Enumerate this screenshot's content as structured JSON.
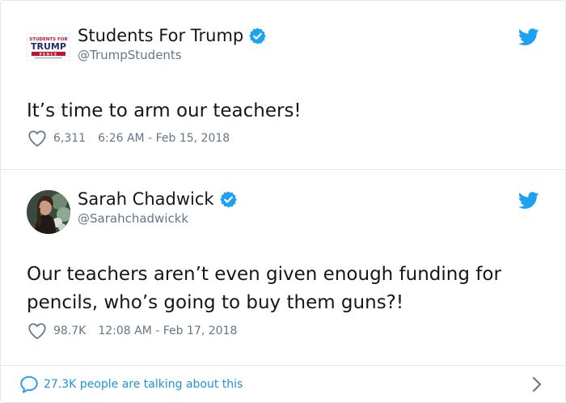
{
  "tweets": [
    {
      "display_name": "Students For Trump",
      "handle": "@TrumpStudents",
      "verified": true,
      "avatar_logo": {
        "top": "STUDENTS FOR",
        "main": "TRUMP",
        "bottom": "PENCE"
      },
      "text": "It’s time to arm our teachers!",
      "likes": "6,311",
      "timestamp": "6:26 AM - Feb 15, 2018"
    },
    {
      "display_name": "Sarah Chadwick",
      "handle": "@Sarahchadwickk",
      "verified": true,
      "text": "Our teachers aren’t even given enough funding for pencils, who’s going to buy them guns?!",
      "likes": "98.7K",
      "timestamp": "12:08 AM - Feb 17, 2018"
    }
  ],
  "footer": {
    "talking_label": "27.3K people are talking about this"
  },
  "icons": {
    "verified": "verified-badge-icon",
    "bird": "twitter-bird-icon",
    "like": "heart-icon",
    "reply": "speech-bubble-icon",
    "more": "chevron-right-icon"
  },
  "colors": {
    "brand_blue": "#1da1f2",
    "link_blue": "#1b95e0",
    "text": "#14171a",
    "muted": "#657786",
    "border": "#e1e8ed"
  }
}
